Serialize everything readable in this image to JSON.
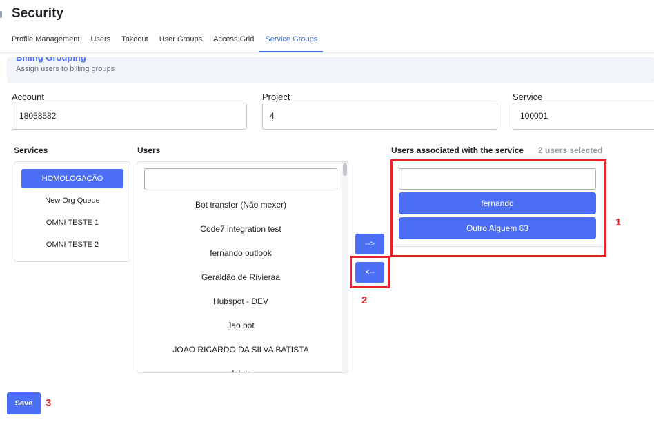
{
  "page": {
    "title": "Security"
  },
  "tabs": [
    {
      "label": "Profile Management"
    },
    {
      "label": "Users"
    },
    {
      "label": "Takeout"
    },
    {
      "label": "User Groups"
    },
    {
      "label": "Access Grid"
    },
    {
      "label": "Service Groups",
      "active": true
    }
  ],
  "billing": {
    "title": "Billing Grouping",
    "subtitle": "Assign users to billing groups"
  },
  "fields": {
    "account": {
      "label": "Account",
      "value": "18058582"
    },
    "project": {
      "label": "Project",
      "value": "4"
    },
    "service": {
      "label": "Service",
      "value": "100001"
    }
  },
  "services": {
    "heading": "Services",
    "items": [
      {
        "label": "HOMOLOGAÇÃO",
        "selected": true
      },
      {
        "label": "New Org Queue"
      },
      {
        "label": "OMNI TESTE 1"
      },
      {
        "label": "OMNI TESTE 2"
      }
    ]
  },
  "users": {
    "heading": "Users",
    "search_value": "",
    "items": [
      {
        "label": "Bot transfer (Não mexer)"
      },
      {
        "label": "Code7 integration test"
      },
      {
        "label": "fernando outlook"
      },
      {
        "label": "Geraldão de Rívieraa"
      },
      {
        "label": "Hubspot - DEV"
      },
      {
        "label": "Jao bot"
      },
      {
        "label": "JOAO RICARDO DA SILVA BATISTA"
      },
      {
        "label": "Jaiulo"
      }
    ]
  },
  "move": {
    "add_label": "-->",
    "remove_label": "<--"
  },
  "associated": {
    "heading": "Users associated with the service",
    "count_label": "2 users selected",
    "search_value": "",
    "items": [
      {
        "label": "fernando"
      },
      {
        "label": "Outro Alguem 63"
      }
    ]
  },
  "annotations": {
    "one": "1",
    "two": "2",
    "three": "3"
  },
  "actions": {
    "save_label": "Save"
  },
  "colors": {
    "accent": "#4b6ef5",
    "annotation": "#e3242b"
  }
}
